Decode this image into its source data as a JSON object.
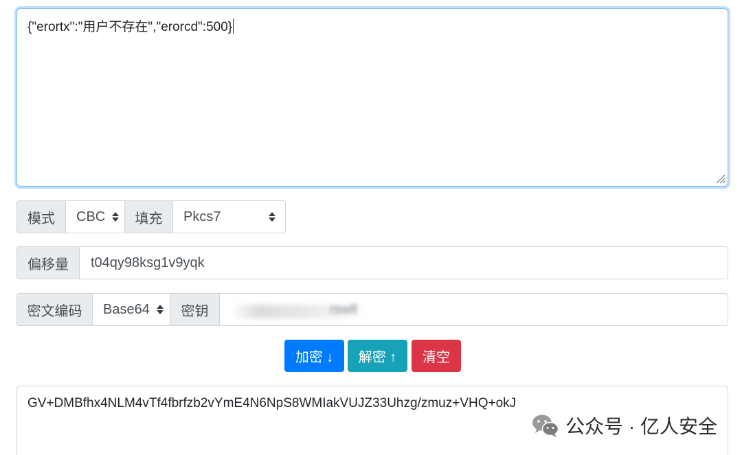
{
  "input": {
    "value": "{\"erortx\":\"用户不存在\",\"erorcd\":500}"
  },
  "row_mode": {
    "mode_label": "模式",
    "mode_value": "CBC",
    "padding_label": "填充",
    "padding_value": "Pkcs7"
  },
  "row_iv": {
    "iv_label": "偏移量",
    "iv_value": "t04qy98ksg1v9yqk"
  },
  "row_key": {
    "encoding_label": "密文编码",
    "encoding_value": "Base64",
    "key_label": "密钥",
    "key_value_visible": "rswll"
  },
  "buttons": {
    "encrypt_label": "加密 ↓",
    "decrypt_label": "解密 ↑",
    "clear_label": "清空"
  },
  "output": {
    "value": "GV+DMBfhx4NLM4vTf4fbrfzb2vYmE4N6NpS8WMIakVUJZ33Uhzg/zmuz+VHQ+okJ"
  },
  "watermark": {
    "text": "公众号 · 亿人安全",
    "icon": "wechat-icon"
  },
  "colors": {
    "primary": "#007bff",
    "info": "#17a2b8",
    "danger": "#dc3545",
    "focus_border": "#80bdff",
    "addon_bg": "#e9ecef"
  }
}
